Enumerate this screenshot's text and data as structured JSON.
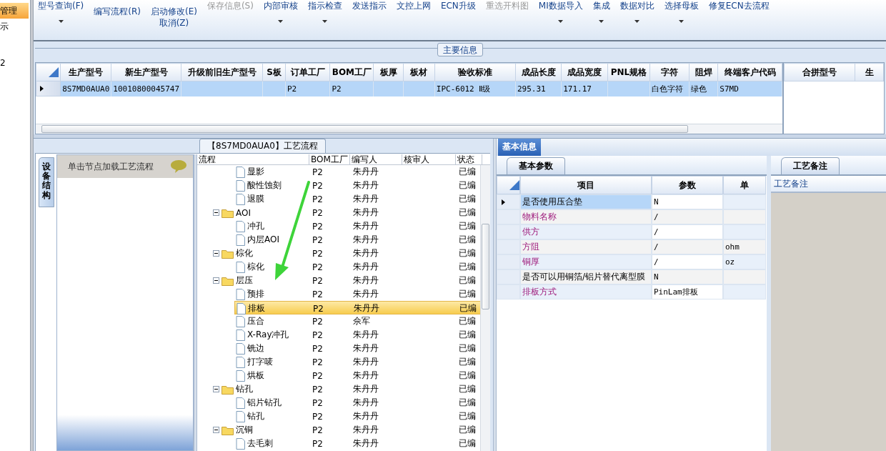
{
  "left_strip": {
    "items": [
      {
        "label": "管理",
        "selected": true
      },
      {
        "label": "示",
        "selected": false
      },
      {
        "label": "2",
        "selected": false
      }
    ]
  },
  "ribbon": [
    {
      "kind": "large",
      "lines": [
        "型号查询(F)"
      ],
      "dropdown": true,
      "disabled": false
    },
    {
      "kind": "small",
      "lines": [
        "编写流程(R)"
      ],
      "dropdown": false,
      "disabled": false
    },
    {
      "kind": "small",
      "lines": [
        "启动修改(E)",
        "取消(Z)"
      ],
      "dropdown": false,
      "disabled": false
    },
    {
      "kind": "large",
      "lines": [
        "保存信息(S)"
      ],
      "dropdown": false,
      "disabled": true
    },
    {
      "kind": "large",
      "lines": [
        "内部审核"
      ],
      "dropdown": true,
      "disabled": false
    },
    {
      "kind": "large",
      "lines": [
        "指示检查"
      ],
      "dropdown": true,
      "disabled": false
    },
    {
      "kind": "large",
      "lines": [
        "发送指示"
      ],
      "dropdown": false,
      "disabled": false
    },
    {
      "kind": "large",
      "lines": [
        "文控上网"
      ],
      "dropdown": false,
      "disabled": false
    },
    {
      "kind": "large",
      "lines": [
        "ECN升级"
      ],
      "dropdown": false,
      "disabled": false
    },
    {
      "kind": "large",
      "lines": [
        "重选开料图"
      ],
      "dropdown": false,
      "disabled": true
    },
    {
      "kind": "large",
      "lines": [
        "MI数据导入"
      ],
      "dropdown": true,
      "disabled": false
    },
    {
      "kind": "large",
      "lines": [
        "集成"
      ],
      "dropdown": true,
      "disabled": false
    },
    {
      "kind": "large",
      "lines": [
        "数据对比"
      ],
      "dropdown": true,
      "disabled": false
    },
    {
      "kind": "large",
      "lines": [
        "选择母板"
      ],
      "dropdown": true,
      "disabled": false
    },
    {
      "kind": "large",
      "lines": [
        "修复ECN去流程"
      ],
      "dropdown": false,
      "disabled": false
    }
  ],
  "main_info": {
    "title": "主要信息",
    "columns": [
      "生产型号",
      "新生产型号",
      "升级前旧生产型号",
      "S板",
      "订单工厂",
      "BOM工厂",
      "板厚",
      "板材",
      "验收标准",
      "成品长度",
      "成品宽度",
      "PNL规格",
      "字符",
      "阻焊",
      "终端客户代码"
    ],
    "rows": [
      {
        "selected": true,
        "cells": [
          "8S7MD0AUA0",
          "10010800045747",
          "",
          "",
          "P2",
          "P2",
          "",
          "",
          "IPC-6012 Ⅱ级",
          "295.31",
          "171.17",
          "",
          "白色字符",
          "绿色",
          "S7MD"
        ]
      }
    ],
    "side_columns": [
      "合拼型号",
      "生"
    ]
  },
  "process_panel": {
    "title": "【8S7MD0AUA0】工艺流程",
    "side_tab": "设备结构",
    "hint": "单击节点加载工艺流程",
    "columns": [
      "流程",
      "BOM工厂",
      "编写人",
      "核审人",
      "状态"
    ],
    "tree": [
      {
        "kind": "leaf",
        "name": "显影",
        "bom": "P2",
        "writer": "朱丹丹",
        "status": "已编",
        "selected": false
      },
      {
        "kind": "leaf",
        "name": "酸性蚀刻",
        "bom": "P2",
        "writer": "朱丹丹",
        "status": "已编",
        "selected": false
      },
      {
        "kind": "leaf",
        "name": "退膜",
        "bom": "P2",
        "writer": "朱丹丹",
        "status": "已编",
        "selected": false
      },
      {
        "kind": "folder",
        "name": "AOI",
        "bom": "P2",
        "writer": "朱丹丹",
        "status": "已编",
        "selected": false,
        "expanded": true,
        "children": [
          {
            "kind": "leaf",
            "name": "冲孔",
            "bom": "P2",
            "writer": "朱丹丹",
            "status": "已编",
            "selected": false
          },
          {
            "kind": "leaf",
            "name": "内层AOI",
            "bom": "P2",
            "writer": "朱丹丹",
            "status": "已编",
            "selected": false
          }
        ]
      },
      {
        "kind": "folder",
        "name": "棕化",
        "bom": "P2",
        "writer": "朱丹丹",
        "status": "已编",
        "selected": false,
        "expanded": true,
        "children": [
          {
            "kind": "leaf",
            "name": "棕化",
            "bom": "P2",
            "writer": "朱丹丹",
            "status": "已编",
            "selected": false
          }
        ]
      },
      {
        "kind": "folder",
        "name": "层压",
        "bom": "P2",
        "writer": "朱丹丹",
        "status": "已编",
        "selected": false,
        "expanded": true,
        "children": [
          {
            "kind": "leaf",
            "name": "预排",
            "bom": "P2",
            "writer": "朱丹丹",
            "status": "已编",
            "selected": false
          },
          {
            "kind": "leaf",
            "name": "排板",
            "bom": "P2",
            "writer": "朱丹丹",
            "status": "已编",
            "selected": true
          },
          {
            "kind": "leaf",
            "name": "压合",
            "bom": "P2",
            "writer": "佘军",
            "status": "已编",
            "selected": false
          },
          {
            "kind": "leaf",
            "name": "X-Ray冲孔",
            "bom": "P2",
            "writer": "朱丹丹",
            "status": "已编",
            "selected": false
          },
          {
            "kind": "leaf",
            "name": "铣边",
            "bom": "P2",
            "writer": "朱丹丹",
            "status": "已编",
            "selected": false
          },
          {
            "kind": "leaf",
            "name": "打字唛",
            "bom": "P2",
            "writer": "朱丹丹",
            "status": "已编",
            "selected": false
          },
          {
            "kind": "leaf",
            "name": "烘板",
            "bom": "P2",
            "writer": "朱丹丹",
            "status": "已编",
            "selected": false
          }
        ]
      },
      {
        "kind": "folder",
        "name": "钻孔",
        "bom": "P2",
        "writer": "朱丹丹",
        "status": "已编",
        "selected": false,
        "expanded": true,
        "children": [
          {
            "kind": "leaf",
            "name": "铝片钻孔",
            "bom": "P2",
            "writer": "朱丹丹",
            "status": "已编",
            "selected": false
          },
          {
            "kind": "leaf",
            "name": "钻孔",
            "bom": "P2",
            "writer": "朱丹丹",
            "status": "已编",
            "selected": false
          }
        ]
      },
      {
        "kind": "folder",
        "name": "沉铜",
        "bom": "P2",
        "writer": "朱丹丹",
        "status": "已编",
        "selected": false,
        "expanded": true,
        "children": [
          {
            "kind": "leaf",
            "name": "去毛刺",
            "bom": "P2",
            "writer": "朱丹丹",
            "status": "已编",
            "selected": false
          }
        ]
      }
    ]
  },
  "basic_info": {
    "tab": {
      "label": "基本信息",
      "selected": true
    },
    "sub_tab": "基本参数",
    "columns": [
      "项目",
      "参数",
      "单"
    ],
    "rows": [
      {
        "item": "是否使用压合垫",
        "value": "N",
        "unit": "",
        "highlighted": false,
        "selected": true
      },
      {
        "item": "物料名称",
        "value": "/",
        "unit": "",
        "highlighted": true,
        "selected": false
      },
      {
        "item": "供方",
        "value": "/",
        "unit": "",
        "highlighted": true,
        "selected": false
      },
      {
        "item": "方阻",
        "value": "/",
        "unit": "ohm",
        "highlighted": true,
        "selected": false
      },
      {
        "item": "铜厚",
        "value": "/",
        "unit": "oz",
        "highlighted": true,
        "selected": false
      },
      {
        "item": "是否可以用铜箔/铝片替代离型膜",
        "value": "N",
        "unit": "",
        "highlighted": false,
        "selected": false
      },
      {
        "item": "排板方式",
        "value": "PinLam排板",
        "unit": "",
        "highlighted": true,
        "selected": false
      }
    ]
  },
  "remarks": {
    "tab": "工艺备注",
    "header": "工艺备注"
  }
}
